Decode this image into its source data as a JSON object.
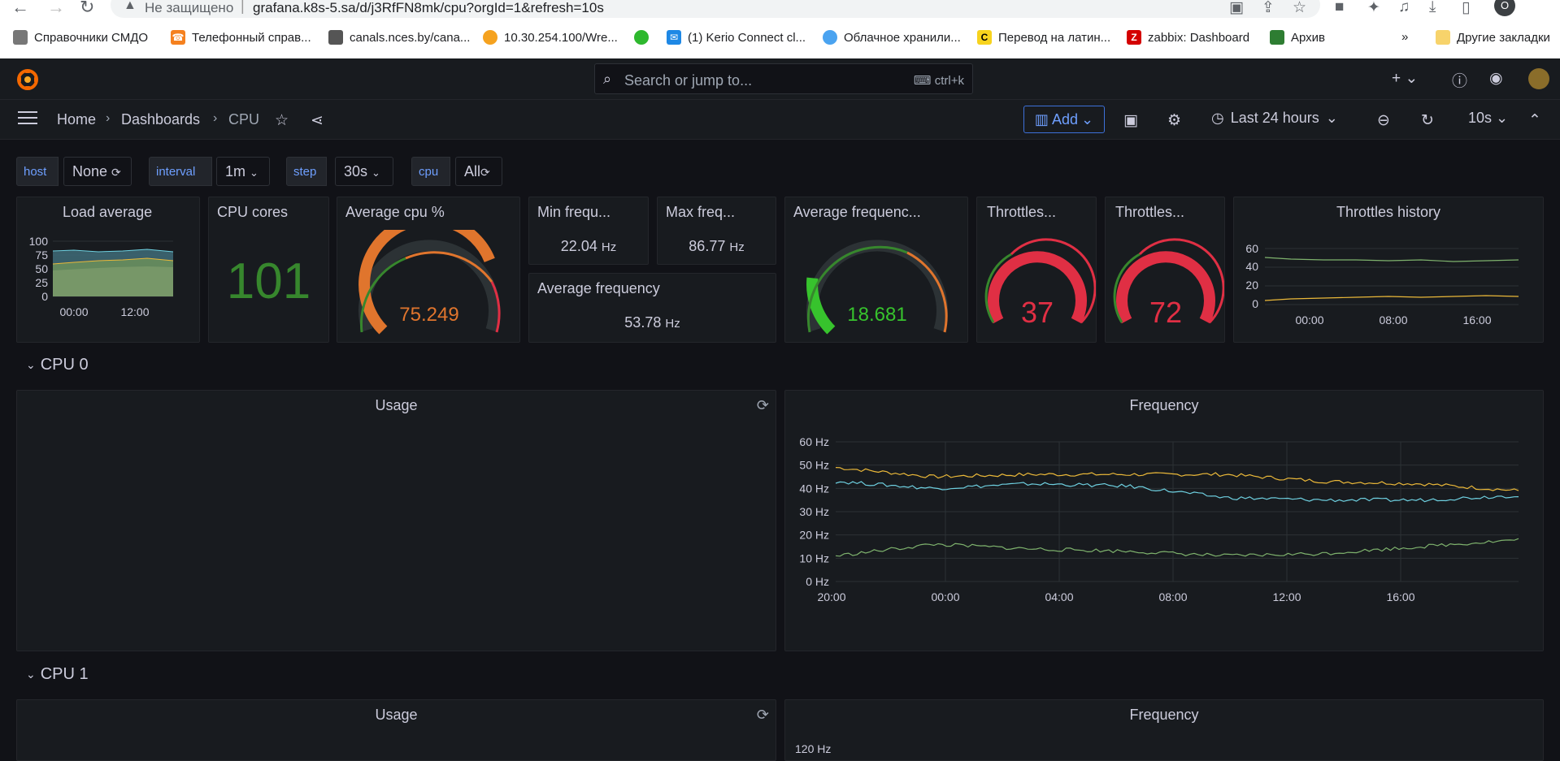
{
  "browser": {
    "insecure_label": "Не защищено",
    "url": "grafana.k8s-5.sa/d/j3RfFN8mk/cpu?orgId=1&refresh=10s",
    "profile_initial": "O",
    "bookmarks": [
      {
        "label": "Справочники СМДО"
      },
      {
        "label": "Телефонный справ..."
      },
      {
        "label": "canals.nces.by/cana..."
      },
      {
        "label": "10.30.254.100/Wre..."
      },
      {
        "label": ""
      },
      {
        "label": "(1) Kerio Connect cl..."
      },
      {
        "label": "Облачное хранили..."
      },
      {
        "label": "Перевод на латин..."
      },
      {
        "label": "zabbix: Dashboard"
      },
      {
        "label": "Архив"
      }
    ],
    "more_bookmarks": "»",
    "other_bookmarks": "Другие закладки"
  },
  "topbar": {
    "search_placeholder": "Search or jump to...",
    "search_shortcut": "ctrl+k"
  },
  "nav": {
    "breadcrumbs": [
      "Home",
      "Dashboards",
      "CPU"
    ],
    "add_label": "Add",
    "time_range": "Last 24 hours",
    "refresh_interval": "10s"
  },
  "variables": [
    {
      "label": "host",
      "value": "None"
    },
    {
      "label": "interval",
      "value": "1m"
    },
    {
      "label": "step",
      "value": "30s"
    },
    {
      "label": "cpu",
      "value": "All"
    }
  ],
  "panels": {
    "load_average": {
      "title": "Load average",
      "y_ticks": [
        "100",
        "75",
        "50",
        "25",
        "0"
      ],
      "x_ticks": [
        "00:00",
        "12:00"
      ]
    },
    "cpu_cores": {
      "title": "CPU cores",
      "value": "101",
      "color": "#37872d"
    },
    "avg_cpu": {
      "title": "Average cpu %",
      "value": "75.249",
      "fraction": 0.75249,
      "color": "#e0752d"
    },
    "min_freq": {
      "title": "Min frequ...",
      "value": "22.04",
      "unit": "Hz"
    },
    "max_freq": {
      "title": "Max freq...",
      "value": "86.77",
      "unit": "Hz"
    },
    "avg_freq_stat": {
      "title": "Average frequency",
      "value": "53.78",
      "unit": "Hz"
    },
    "avg_freq_gauge": {
      "title": "Average frequenc...",
      "value": "18.681",
      "fraction": 0.187,
      "color": "#37c32d"
    },
    "throttles_1": {
      "title": "Throttles...",
      "value": "37",
      "color": "#e02f44"
    },
    "throttles_2": {
      "title": "Throttles...",
      "value": "72",
      "color": "#e02f44"
    },
    "throttles_history": {
      "title": "Throttles history",
      "y_ticks": [
        "60",
        "40",
        "20",
        "0"
      ],
      "x_ticks": [
        "00:00",
        "08:00",
        "16:00"
      ]
    }
  },
  "rows": [
    {
      "title": "CPU 0",
      "usage_title": "Usage",
      "freq_title": "Frequency"
    },
    {
      "title": "CPU 1",
      "usage_title": "Usage",
      "freq_title": "Frequency",
      "freq_first_tick": "120 Hz"
    }
  ],
  "chart_data": [
    {
      "type": "line",
      "title": "Frequency",
      "x": [
        "20:00",
        "00:00",
        "04:00",
        "08:00",
        "12:00",
        "16:00"
      ],
      "ylim": [
        0,
        60
      ],
      "y_ticks": [
        "0 Hz",
        "10 Hz",
        "20 Hz",
        "30 Hz",
        "40 Hz",
        "50 Hz",
        "60 Hz"
      ],
      "series": [
        {
          "color": "#eab839",
          "values": [
            49,
            45,
            46,
            46,
            46,
            43,
            42,
            39
          ]
        },
        {
          "color": "#6ed0e0",
          "values": [
            43,
            40,
            42,
            41,
            36,
            35,
            35,
            37
          ]
        },
        {
          "color": "#7eb26d",
          "values": [
            11,
            16,
            14,
            13,
            11,
            12,
            15,
            18
          ]
        }
      ]
    }
  ]
}
